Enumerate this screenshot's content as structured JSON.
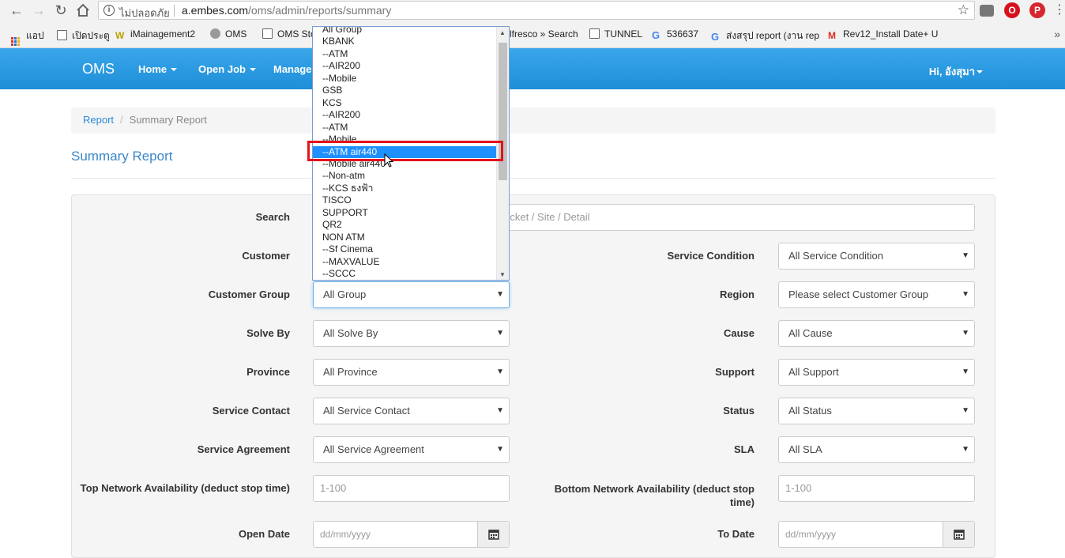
{
  "browser": {
    "secure_label": "ไม่ปลอดภัย",
    "url_host": "a.embes.com",
    "url_path": "/oms/admin/reports/summary"
  },
  "bookmarks": {
    "apps": "แอป",
    "items": [
      "เปิดประตู",
      "iMainagement2",
      "OMS",
      "OMS Sto",
      "lfresco » Search",
      "TUNNEL",
      "536637",
      "ส่งสรุป report (งาน rep",
      "Rev12_Install Date+ U"
    ],
    "more": "»"
  },
  "navbar": {
    "brand": "OMS",
    "items": [
      "Home",
      "Open Job",
      "Manage"
    ],
    "user": "Hi, อังสุมา"
  },
  "breadcrumb": {
    "link": "Report",
    "active": "Summary Report",
    "divider": "/"
  },
  "page_title": "Summary Report",
  "form": {
    "search_label": "Search",
    "search_placeholder": "Ticket / Site / Detail",
    "customer_label": "Customer",
    "service_condition_label": "Service Condition",
    "service_condition_value": "All Service Condition",
    "customer_group_label": "Customer Group",
    "customer_group_value": "All Group",
    "region_label": "Region",
    "region_value": "Please select Customer Group",
    "solve_by_label": "Solve By",
    "solve_by_value": "All Solve By",
    "cause_label": "Cause",
    "cause_value": "All Cause",
    "province_label": "Province",
    "province_value": "All Province",
    "support_label": "Support",
    "support_value": "All Support",
    "service_contact_label": "Service Contact",
    "service_contact_value": "All Service Contact",
    "status_label": "Status",
    "status_value": "All Status",
    "service_agreement_label": "Service Agreement",
    "service_agreement_value": "All Service Agreement",
    "sla_label": "SLA",
    "sla_value": "All SLA",
    "top_network_label": "Top Network Availability (deduct stop time)",
    "top_network_placeholder": "1-100",
    "bottom_network_label_1": "Bottom Network Availability (deduct stop",
    "bottom_network_label_2": "time)",
    "bottom_network_placeholder": "1-100",
    "open_date_label": "Open Date",
    "open_date_placeholder": "dd/mm/yyyy",
    "to_date_label": "To Date",
    "to_date_placeholder": "dd/mm/yyyy"
  },
  "dropdown": {
    "options": [
      "All Group",
      "KBANK",
      "--ATM",
      "--AIR200",
      "--Mobile",
      "GSB",
      "KCS",
      "--AIR200",
      "--ATM",
      "--Mobile",
      "--ATM air440",
      "--Mobile air440",
      "--Non-atm",
      "--KCS ธงฟ้า",
      "TISCO",
      "SUPPORT",
      "QR2",
      "NON ATM",
      "--Sf Cinema",
      "--MAXVALUE",
      "--SCCC"
    ],
    "selected_index": 10
  },
  "colors": {
    "navbar": "#2196e0",
    "highlight": "#e3121b",
    "selected": "#1e90ff",
    "title": "#3a87c8"
  }
}
